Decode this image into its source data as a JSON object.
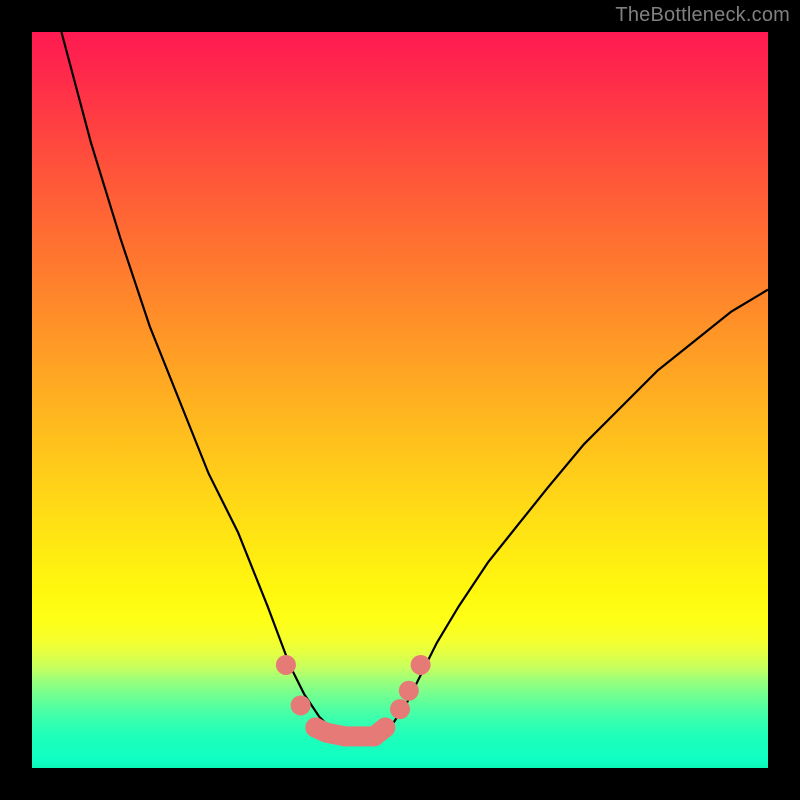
{
  "watermark": "TheBottleneck.com",
  "chart_data": {
    "type": "line",
    "title": "",
    "xlabel": "",
    "ylabel": "",
    "xlim": [
      0,
      100
    ],
    "ylim": [
      0,
      100
    ],
    "series": [
      {
        "name": "left-curve",
        "x": [
          4,
          8,
          12,
          16,
          20,
          24,
          28,
          30,
          32,
          33.5,
          35,
          37,
          39,
          41,
          43
        ],
        "values": [
          100,
          85,
          72,
          60,
          50,
          40,
          32,
          27,
          22,
          18,
          14,
          10,
          7,
          5,
          4.5
        ]
      },
      {
        "name": "right-curve",
        "x": [
          47,
          49,
          51,
          53,
          55,
          58,
          62,
          66,
          70,
          75,
          80,
          85,
          90,
          95,
          100
        ],
        "values": [
          4.5,
          6,
          9,
          13,
          17,
          22,
          28,
          33,
          38,
          44,
          49,
          54,
          58,
          62,
          65
        ]
      },
      {
        "name": "markers",
        "x": [
          34.5,
          36.5,
          38.5,
          40.0,
          42.5,
          44.5,
          46.5,
          48.0,
          50.0,
          51.2,
          52.8
        ],
        "values": [
          14.0,
          8.5,
          5.5,
          4.8,
          4.3,
          4.3,
          4.3,
          5.5,
          8.0,
          10.5,
          14.0
        ]
      }
    ],
    "marker_color": "#e67a77",
    "curve_color": "#000000",
    "gradient_stops": [
      {
        "pos": 0.0,
        "color": "#ff1a52"
      },
      {
        "pos": 0.5,
        "color": "#ffb61f"
      },
      {
        "pos": 0.78,
        "color": "#fff80e"
      },
      {
        "pos": 0.9,
        "color": "#74ff90"
      },
      {
        "pos": 1.0,
        "color": "#0bf6b7"
      }
    ]
  }
}
